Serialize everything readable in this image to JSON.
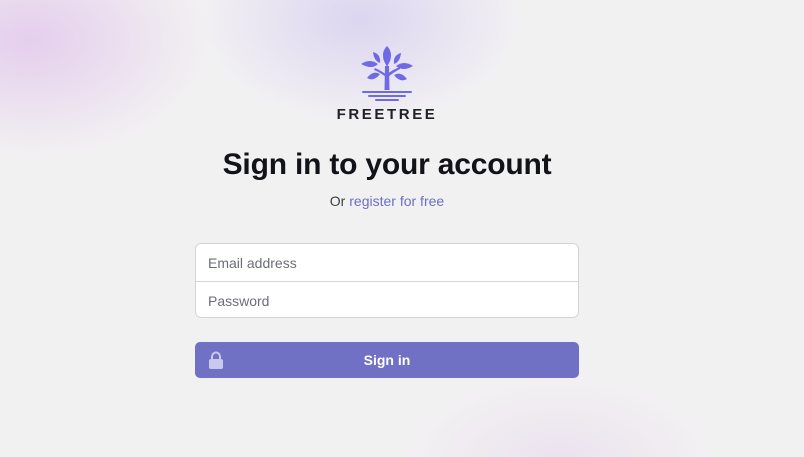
{
  "brand": {
    "logo_icon": "tree-icon",
    "name": "FREETREE",
    "logo_color": "#6e6ae6"
  },
  "header": {
    "title": "Sign in to your account",
    "subtitle_prefix": "Or",
    "register_link": "register for free"
  },
  "form": {
    "email_placeholder": "Email address",
    "password_placeholder": "Password"
  },
  "submit": {
    "label": "Sign in",
    "icon": "lock-icon",
    "color": "#7071c4"
  }
}
